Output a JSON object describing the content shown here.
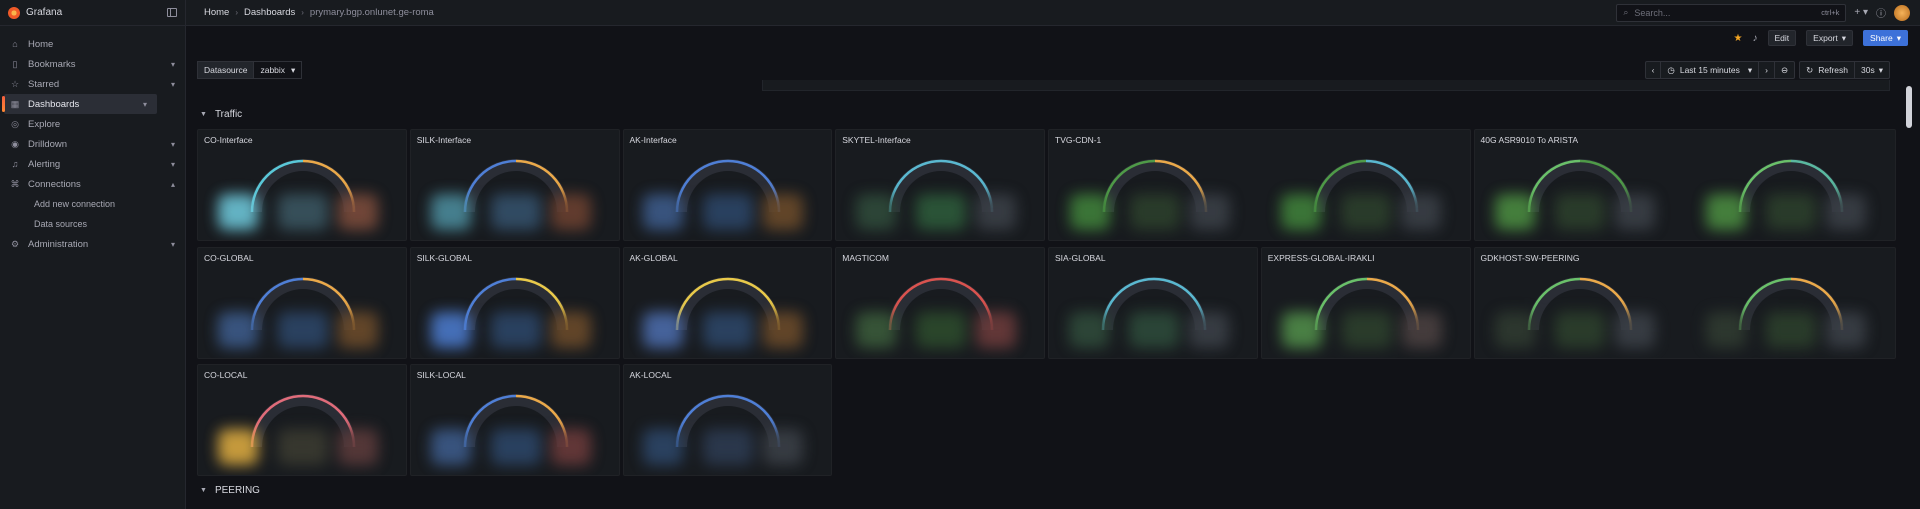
{
  "brand": {
    "name": "Grafana"
  },
  "nav": {
    "items": [
      {
        "label": "Home",
        "icon": "home-icon",
        "glyph": "⌂",
        "chevron": false,
        "active": false
      },
      {
        "label": "Bookmarks",
        "icon": "bookmark-icon",
        "glyph": "▯",
        "chevron": true,
        "active": false
      },
      {
        "label": "Starred",
        "icon": "star-icon",
        "glyph": "☆",
        "chevron": true,
        "active": false
      },
      {
        "label": "Dashboards",
        "icon": "dashboards-icon",
        "glyph": "▦",
        "chevron": true,
        "active": true
      },
      {
        "label": "Explore",
        "icon": "explore-icon",
        "glyph": "◎",
        "chevron": false,
        "active": false
      },
      {
        "label": "Drilldown",
        "icon": "drilldown-icon",
        "glyph": "◉",
        "chevron": true,
        "active": false
      },
      {
        "label": "Alerting",
        "icon": "bell-icon",
        "glyph": "♫",
        "chevron": true,
        "active": false
      },
      {
        "label": "Connections",
        "icon": "connections-icon",
        "glyph": "⌘",
        "chevron": true,
        "expanded": true,
        "active": false
      }
    ],
    "sub": [
      "Add new connection",
      "Data sources"
    ],
    "admin": {
      "label": "Administration",
      "icon": "gear-icon",
      "glyph": "⚙"
    }
  },
  "breadcrumb": [
    "Home",
    "Dashboards",
    "prymary.bgp.onlunet.ge-roma"
  ],
  "search": {
    "placeholder": "Search...",
    "shortcut": "ctrl+k"
  },
  "toolbar": {
    "edit": "Edit",
    "export": "Export",
    "share": "Share"
  },
  "variables": {
    "label": "Datasource",
    "value": "zabbix"
  },
  "time": {
    "range": "Last 15 minutes",
    "refresh": "Refresh",
    "interval": "30s"
  },
  "rows": [
    {
      "title": "Traffic"
    },
    {
      "title": "PEERING"
    }
  ],
  "panels": [
    {
      "title": "CO-Interface",
      "row": 0,
      "col": 0,
      "span": 1,
      "arcs": [
        "#5ac8d8",
        "#eaa94a"
      ],
      "blobs": [
        "#6cc3d5",
        "#3a5560",
        "#7a4b3b"
      ]
    },
    {
      "title": "SILK-Interface",
      "row": 0,
      "col": 1,
      "span": 1,
      "arcs": [
        "#4f7fd6",
        "#eaa94a"
      ],
      "blobs": [
        "#4b8a9a",
        "#34506a",
        "#6a4030"
      ]
    },
    {
      "title": "AK-Interface",
      "row": 0,
      "col": 2,
      "span": 1,
      "arcs": [
        "#4f7fd6",
        "#4f7fd6"
      ],
      "blobs": [
        "#3c5a88",
        "#2c4566",
        "#6a4a2a"
      ]
    },
    {
      "title": "SKYTEL-Interface",
      "row": 0,
      "col": 3,
      "span": 1,
      "arcs": [
        "#5ab8d0",
        "#5ab8d0"
      ],
      "blobs": [
        "#2f4a3a",
        "#2d5a3a",
        "#3a3f46"
      ]
    },
    {
      "title": "TVG-CDN-1",
      "row": 0,
      "col": 4,
      "span": 2,
      "arcs": [
        "#4f9a48",
        "#eaa94a"
      ],
      "arcs2": [
        "#4f9a48",
        "#5ab8d0"
      ],
      "blobs": [
        "#3f7f3a",
        "#2c3f2c",
        "#3a3f46"
      ]
    },
    {
      "title": "40G ASR9010 To ARISTA",
      "row": 0,
      "col": 6,
      "span": 2,
      "arcs": [
        "#6ac06a",
        "#4f9a48"
      ],
      "arcs2": [
        "#6ac06a",
        "#5ab8a0"
      ],
      "blobs": [
        "#4a8a40",
        "#2c3f2c",
        "#3a3f46"
      ]
    },
    {
      "title": "CO-GLOBAL",
      "row": 1,
      "col": 0,
      "span": 1,
      "arcs": [
        "#4f7fd6",
        "#eaa94a"
      ],
      "blobs": [
        "#3c5a88",
        "#2c4566",
        "#6a4a2a"
      ]
    },
    {
      "title": "SILK-GLOBAL",
      "row": 1,
      "col": 1,
      "span": 1,
      "arcs": [
        "#4f7fd6",
        "#e8c94a"
      ],
      "blobs": [
        "#4a78c8",
        "#2c4566",
        "#6a4a2a"
      ]
    },
    {
      "title": "AK-GLOBAL",
      "row": 1,
      "col": 2,
      "span": 1,
      "arcs": [
        "#e8c94a",
        "#e8c94a"
      ],
      "blobs": [
        "#4a6aa8",
        "#2c4566",
        "#6a4a2a"
      ]
    },
    {
      "title": "MAGTICOM",
      "row": 1,
      "col": 3,
      "span": 1,
      "arcs": [
        "#d9534f",
        "#d9534f"
      ],
      "blobs": [
        "#3a5a3a",
        "#2c4a2c",
        "#6a3a3a"
      ]
    },
    {
      "title": "SIA-GLOBAL",
      "row": 1,
      "col": 4,
      "span": 1,
      "arcs": [
        "#5ab8d0",
        "#5ab8d0"
      ],
      "blobs": [
        "#2f4a3a",
        "#2d4a3a",
        "#3a3f46"
      ]
    },
    {
      "title": "EXPRESS-GLOBAL-IRAKLI",
      "row": 1,
      "col": 5,
      "span": 1,
      "arcs": [
        "#6ac06a",
        "#eaa94a"
      ],
      "blobs": [
        "#4f8a48",
        "#2c3f2c",
        "#4a4040"
      ]
    },
    {
      "title": "GDKHOST-SW-PEERING",
      "row": 1,
      "col": 6,
      "span": 2,
      "arcs": [
        "#6ac06a",
        "#eaa94a"
      ],
      "arcs2": [
        "#6ac06a",
        "#eaa94a"
      ],
      "blobs": [
        "#2f3a30",
        "#2c3f2c",
        "#3a3f46"
      ]
    },
    {
      "title": "CO-LOCAL",
      "row": 2,
      "col": 0,
      "span": 1,
      "arcs": [
        "#e06c7a",
        "#e06c7a"
      ],
      "blobs": [
        "#d8a840",
        "#3a3a30",
        "#5a3a3a"
      ]
    },
    {
      "title": "SILK-LOCAL",
      "row": 2,
      "col": 1,
      "span": 1,
      "arcs": [
        "#4f7fd6",
        "#eaa94a"
      ],
      "blobs": [
        "#3c5a88",
        "#2c4566",
        "#6a3a3a"
      ]
    },
    {
      "title": "AK-LOCAL",
      "row": 2,
      "col": 2,
      "span": 1,
      "arcs": [
        "#4f7fd6",
        "#4f7fd6"
      ],
      "blobs": [
        "#2c4566",
        "#2c3a50",
        "#3a3f46"
      ]
    }
  ]
}
